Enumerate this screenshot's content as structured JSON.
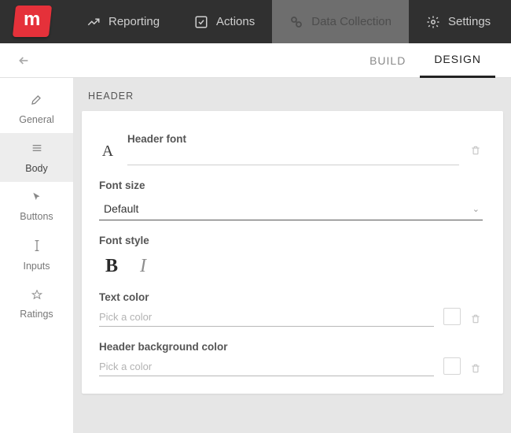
{
  "logo_letter": "m",
  "topnav": {
    "items": [
      {
        "label": "Reporting"
      },
      {
        "label": "Actions"
      },
      {
        "label": "Data Collection"
      },
      {
        "label": "Settings"
      }
    ]
  },
  "subbar": {
    "tabs": [
      {
        "label": "BUILD"
      },
      {
        "label": "DESIGN"
      }
    ]
  },
  "sidebar": {
    "items": [
      {
        "label": "General"
      },
      {
        "label": "Body"
      },
      {
        "label": "Buttons"
      },
      {
        "label": "Inputs"
      },
      {
        "label": "Ratings"
      }
    ]
  },
  "section": {
    "title": "HEADER",
    "header_font_label": "Header font",
    "font_size_label": "Font size",
    "font_size_value": "Default",
    "font_style_label": "Font style",
    "bold_glyph": "B",
    "italic_glyph": "I",
    "text_color_label": "Text color",
    "text_color_placeholder": "Pick a color",
    "bg_color_label": "Header background color",
    "bg_color_placeholder": "Pick a color",
    "font_glyph": "A"
  }
}
